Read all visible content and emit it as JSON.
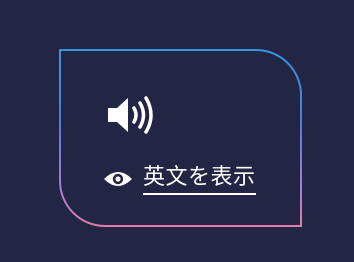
{
  "card": {
    "audio_icon": "speaker-volume-icon",
    "toggle": {
      "icon": "eye-icon",
      "label": "英文を表示"
    }
  },
  "colors": {
    "background": "#222543",
    "border_gradient_top": "#3a93e0",
    "border_gradient_bottom": "#e07ca8",
    "foreground": "#ffffff"
  }
}
